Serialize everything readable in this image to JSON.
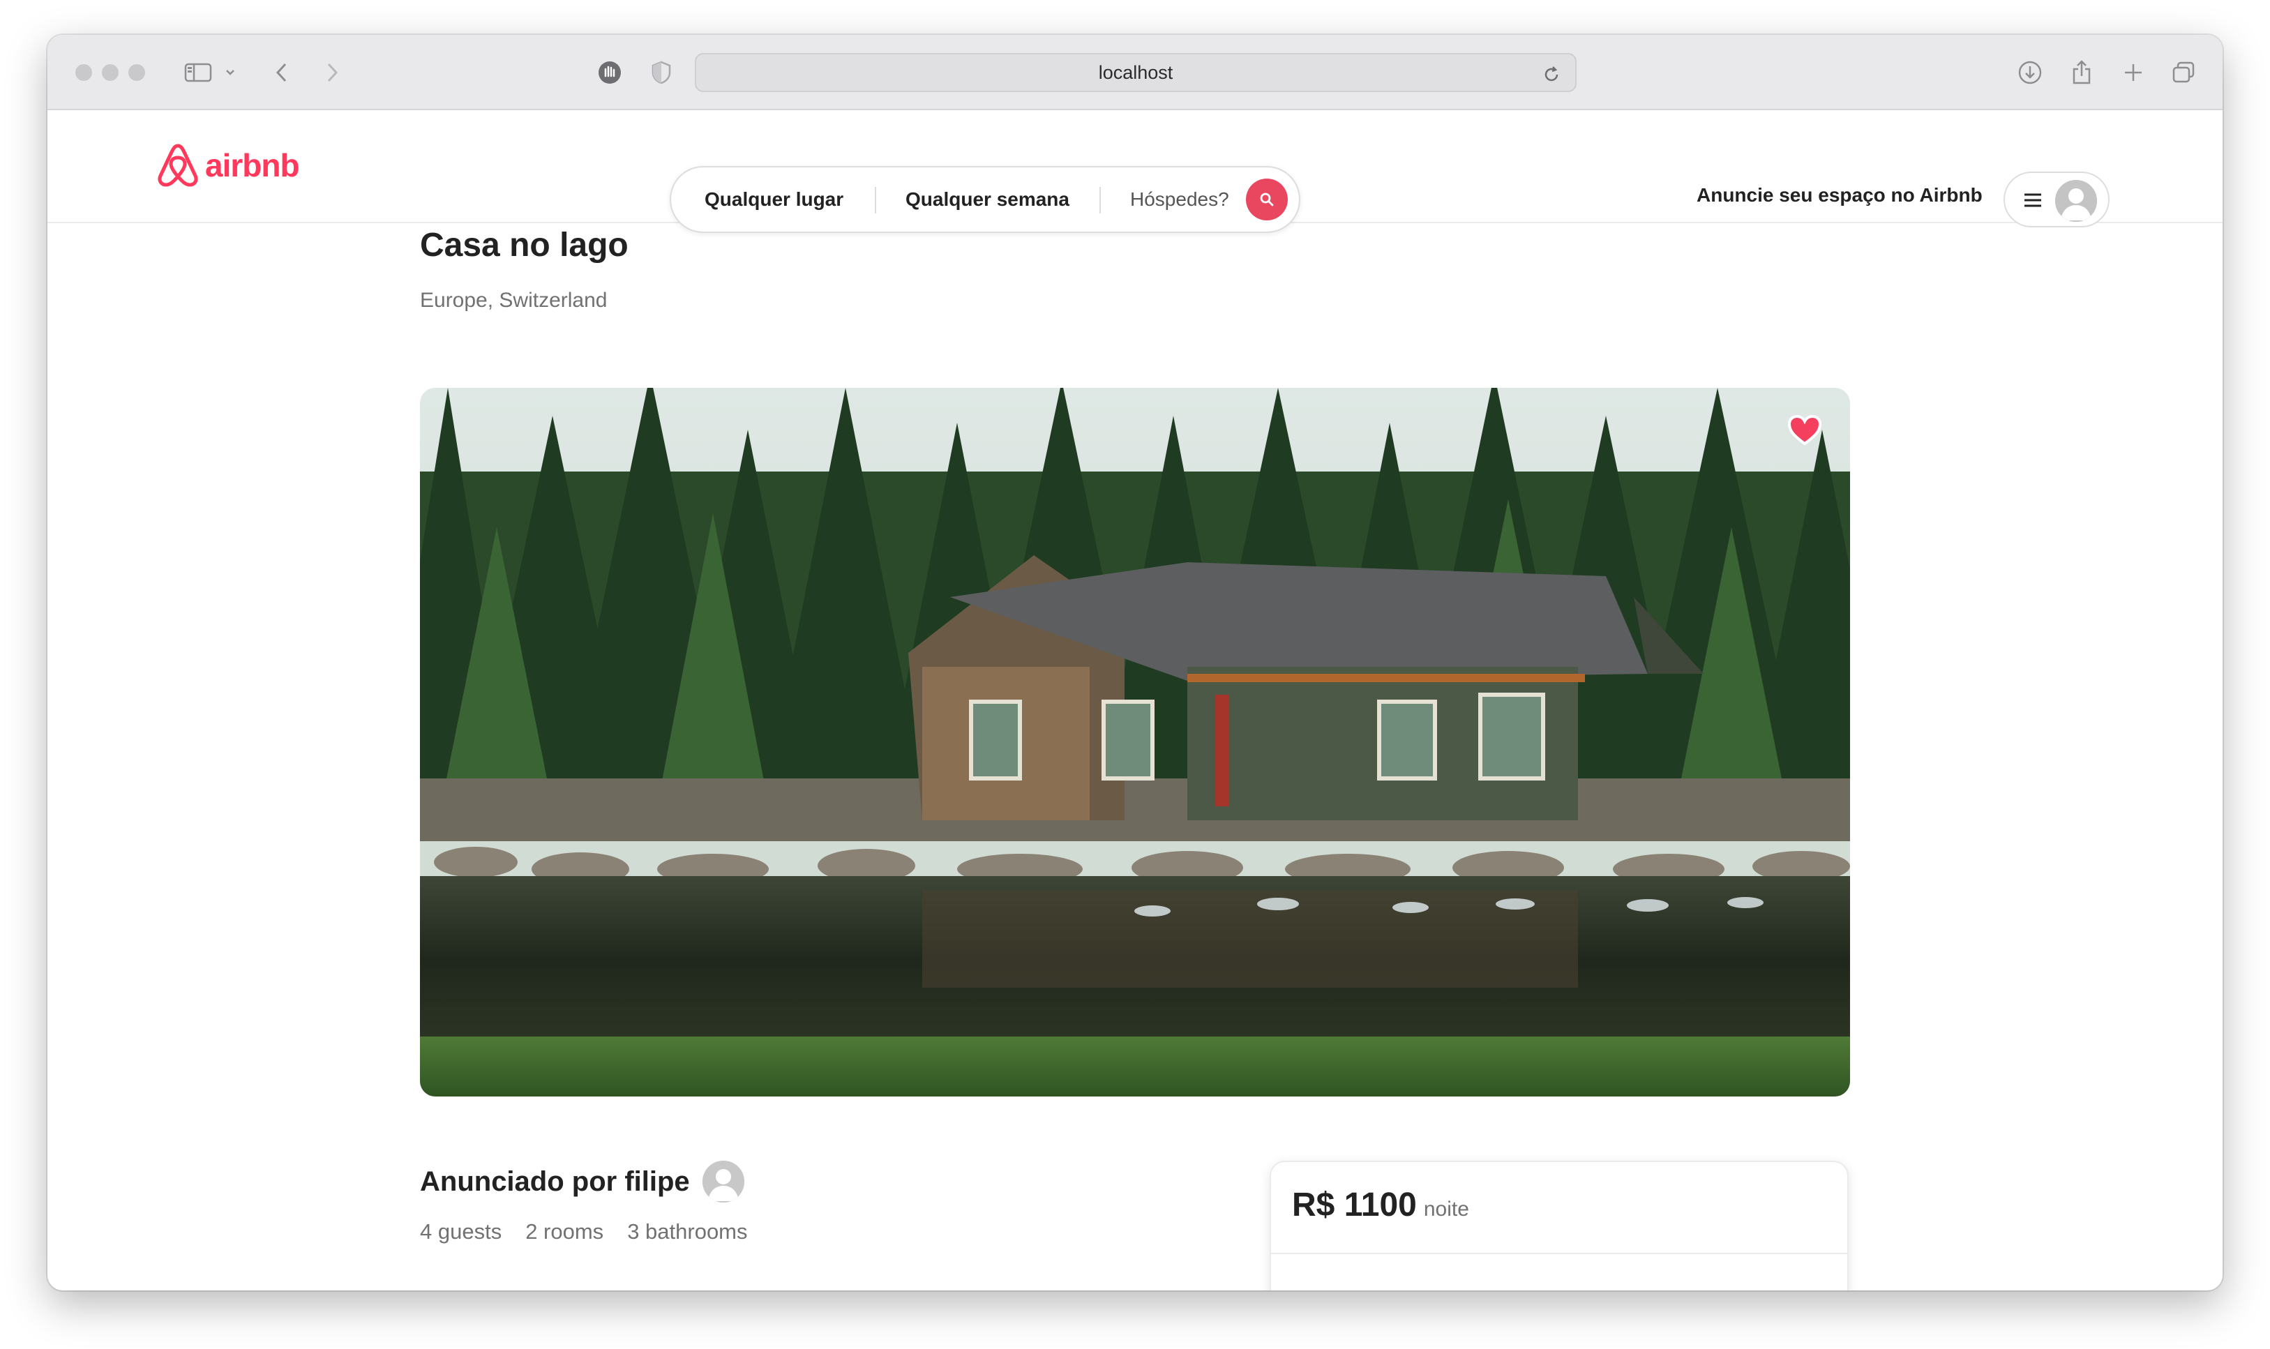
{
  "browser": {
    "url": "localhost"
  },
  "header": {
    "logo_text": "airbnb",
    "search": {
      "location": "Qualquer lugar",
      "week": "Qualquer semana",
      "guests": "Hóspedes?"
    },
    "host_link": "Anuncie seu espaço no Airbnb"
  },
  "listing": {
    "title": "Casa no lago",
    "location": "Europe, Switzerland",
    "host_title": "Anunciado por filipe",
    "guests": "4 guests",
    "rooms": "2 rooms",
    "bathrooms": "3 bathrooms",
    "price": "R$ 1100",
    "price_unit": "noite",
    "favorited": true
  },
  "colors": {
    "brand": "#ff385c",
    "search_button": "#e8475f",
    "favorite": "#f43f5e"
  }
}
